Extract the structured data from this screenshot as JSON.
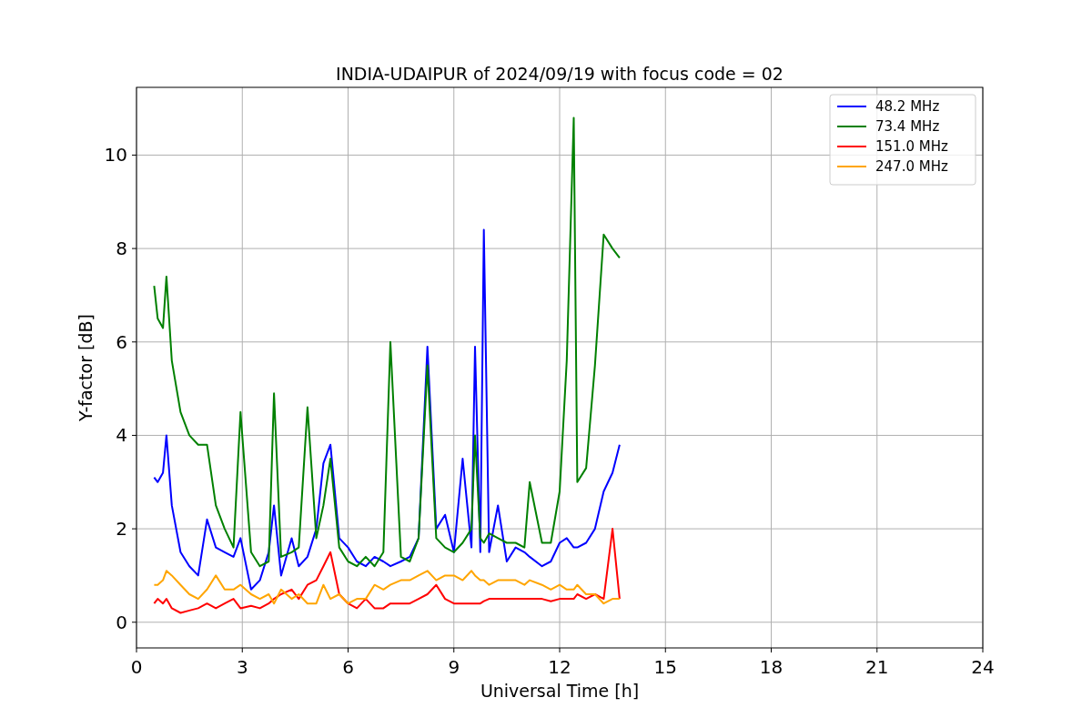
{
  "figure": {
    "chart_data": {
      "type": "line",
      "title": "INDIA-UDAIPUR of 2024/09/19 with focus code = 02",
      "xlabel": "Universal Time [h]",
      "ylabel": "Y-factor [dB]",
      "x": [
        0.5,
        0.6,
        0.75,
        0.85,
        1.0,
        1.25,
        1.5,
        1.75,
        2.0,
        2.25,
        2.5,
        2.75,
        2.95,
        3.25,
        3.5,
        3.75,
        3.9,
        4.1,
        4.4,
        4.6,
        4.85,
        5.1,
        5.3,
        5.5,
        5.75,
        6.0,
        6.25,
        6.5,
        6.75,
        7.0,
        7.2,
        7.5,
        7.75,
        8.0,
        8.25,
        8.5,
        8.75,
        9.0,
        9.25,
        9.5,
        9.6,
        9.75,
        9.85,
        10.0,
        10.25,
        10.5,
        10.75,
        11.0,
        11.15,
        11.5,
        11.75,
        12.0,
        12.2,
        12.4,
        12.5,
        12.75,
        13.0,
        13.25,
        13.5,
        13.7
      ],
      "series": [
        {
          "name": "48.2 MHz",
          "color": "#0000ff",
          "values": [
            3.1,
            3.0,
            3.2,
            4.0,
            2.5,
            1.5,
            1.2,
            1.0,
            2.2,
            1.6,
            1.5,
            1.4,
            1.8,
            0.7,
            0.9,
            1.5,
            2.5,
            1.0,
            1.8,
            1.2,
            1.4,
            2.0,
            3.4,
            3.8,
            1.8,
            1.6,
            1.3,
            1.2,
            1.4,
            1.3,
            1.2,
            1.3,
            1.4,
            1.8,
            5.9,
            2.0,
            2.3,
            1.5,
            3.5,
            1.6,
            5.9,
            1.5,
            8.4,
            1.5,
            2.5,
            1.3,
            1.6,
            1.5,
            1.4,
            1.2,
            1.3,
            1.7,
            1.8,
            1.6,
            1.6,
            1.7,
            2.0,
            2.8,
            3.2,
            3.8
          ]
        },
        {
          "name": "73.4 MHz",
          "color": "#008000",
          "values": [
            7.2,
            6.5,
            6.3,
            7.4,
            5.6,
            4.5,
            4.0,
            3.8,
            3.8,
            2.5,
            2.0,
            1.6,
            4.5,
            1.5,
            1.2,
            1.3,
            4.9,
            1.4,
            1.5,
            1.6,
            4.6,
            1.8,
            2.5,
            3.5,
            1.6,
            1.3,
            1.2,
            1.4,
            1.2,
            1.5,
            6.0,
            1.4,
            1.3,
            1.8,
            5.5,
            1.8,
            1.6,
            1.5,
            1.7,
            2.0,
            4.0,
            1.8,
            1.7,
            1.9,
            1.8,
            1.7,
            1.7,
            1.6,
            3.0,
            1.7,
            1.7,
            2.8,
            5.6,
            10.8,
            3.0,
            3.3,
            5.5,
            8.3,
            8.0,
            7.8
          ]
        },
        {
          "name": "151.0 MHz",
          "color": "#ff0000",
          "values": [
            0.4,
            0.5,
            0.4,
            0.5,
            0.3,
            0.2,
            0.25,
            0.3,
            0.4,
            0.3,
            0.4,
            0.5,
            0.3,
            0.35,
            0.3,
            0.4,
            0.5,
            0.6,
            0.7,
            0.5,
            0.8,
            0.9,
            1.2,
            1.5,
            0.6,
            0.4,
            0.3,
            0.5,
            0.3,
            0.3,
            0.4,
            0.4,
            0.4,
            0.5,
            0.6,
            0.8,
            0.5,
            0.4,
            0.4,
            0.4,
            0.4,
            0.4,
            0.45,
            0.5,
            0.5,
            0.5,
            0.5,
            0.5,
            0.5,
            0.5,
            0.45,
            0.5,
            0.5,
            0.5,
            0.6,
            0.5,
            0.6,
            0.5,
            2.0,
            0.5
          ]
        },
        {
          "name": "247.0 MHz",
          "color": "#ffa500",
          "values": [
            0.8,
            0.8,
            0.9,
            1.1,
            1.0,
            0.8,
            0.6,
            0.5,
            0.7,
            1.0,
            0.7,
            0.7,
            0.8,
            0.6,
            0.5,
            0.6,
            0.4,
            0.7,
            0.5,
            0.6,
            0.4,
            0.4,
            0.8,
            0.5,
            0.6,
            0.4,
            0.5,
            0.5,
            0.8,
            0.7,
            0.8,
            0.9,
            0.9,
            1.0,
            1.1,
            0.9,
            1.0,
            1.0,
            0.9,
            1.1,
            1.0,
            0.9,
            0.9,
            0.8,
            0.9,
            0.9,
            0.9,
            0.8,
            0.9,
            0.8,
            0.7,
            0.8,
            0.7,
            0.7,
            0.8,
            0.6,
            0.6,
            0.4,
            0.5,
            0.5
          ]
        }
      ],
      "xlim": [
        0,
        24
      ],
      "ylim": [
        -0.55,
        11.45
      ],
      "xticks": [
        0,
        3,
        6,
        9,
        12,
        15,
        18,
        21,
        24
      ],
      "yticks": [
        0,
        2,
        4,
        6,
        8,
        10
      ],
      "grid": true,
      "legend": true
    }
  }
}
